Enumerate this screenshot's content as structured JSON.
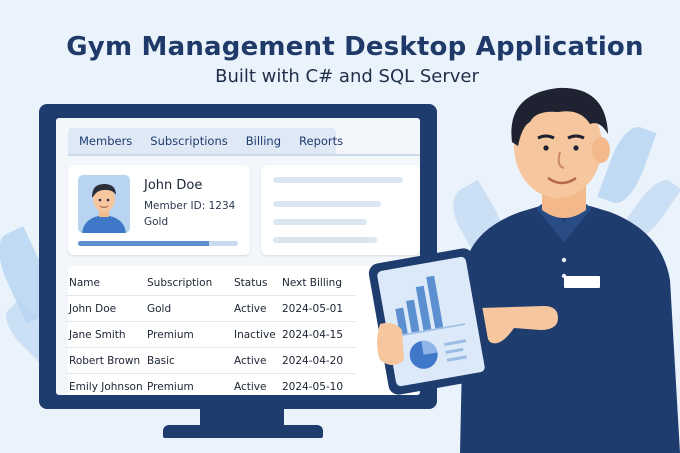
{
  "heading": {
    "title": "Gym Management Desktop Application",
    "subtitle": "Built with C# and SQL Server"
  },
  "app": {
    "tabs": [
      "Members",
      "Subscriptions",
      "Billing",
      "Reports"
    ],
    "member_card": {
      "name": "John Doe",
      "member_id": "Member ID: 1234",
      "tier": "Gold",
      "progress_fraction": 0.82
    },
    "table": {
      "columns": [
        "Name",
        "Subscription",
        "Status",
        "Next Billing"
      ],
      "rows": [
        [
          "John Doe",
          "Gold",
          "Active",
          "2024-05-01"
        ],
        [
          "Jane Smith",
          "Premium",
          "Inactive",
          "2024-04-15"
        ],
        [
          "Robert Brown",
          "Basic",
          "Active",
          "2024-04-20"
        ],
        [
          "Emily Johnson",
          "Premium",
          "Active",
          "2024-05-10"
        ]
      ]
    }
  },
  "colors": {
    "brand_navy": "#1f3c6e",
    "accent_blue": "#5b8fd0",
    "background": "#eaf2fb"
  },
  "icons": [
    "member-avatar",
    "bar-chart-icon",
    "pie-chart-icon",
    "presenter-illustration"
  ]
}
